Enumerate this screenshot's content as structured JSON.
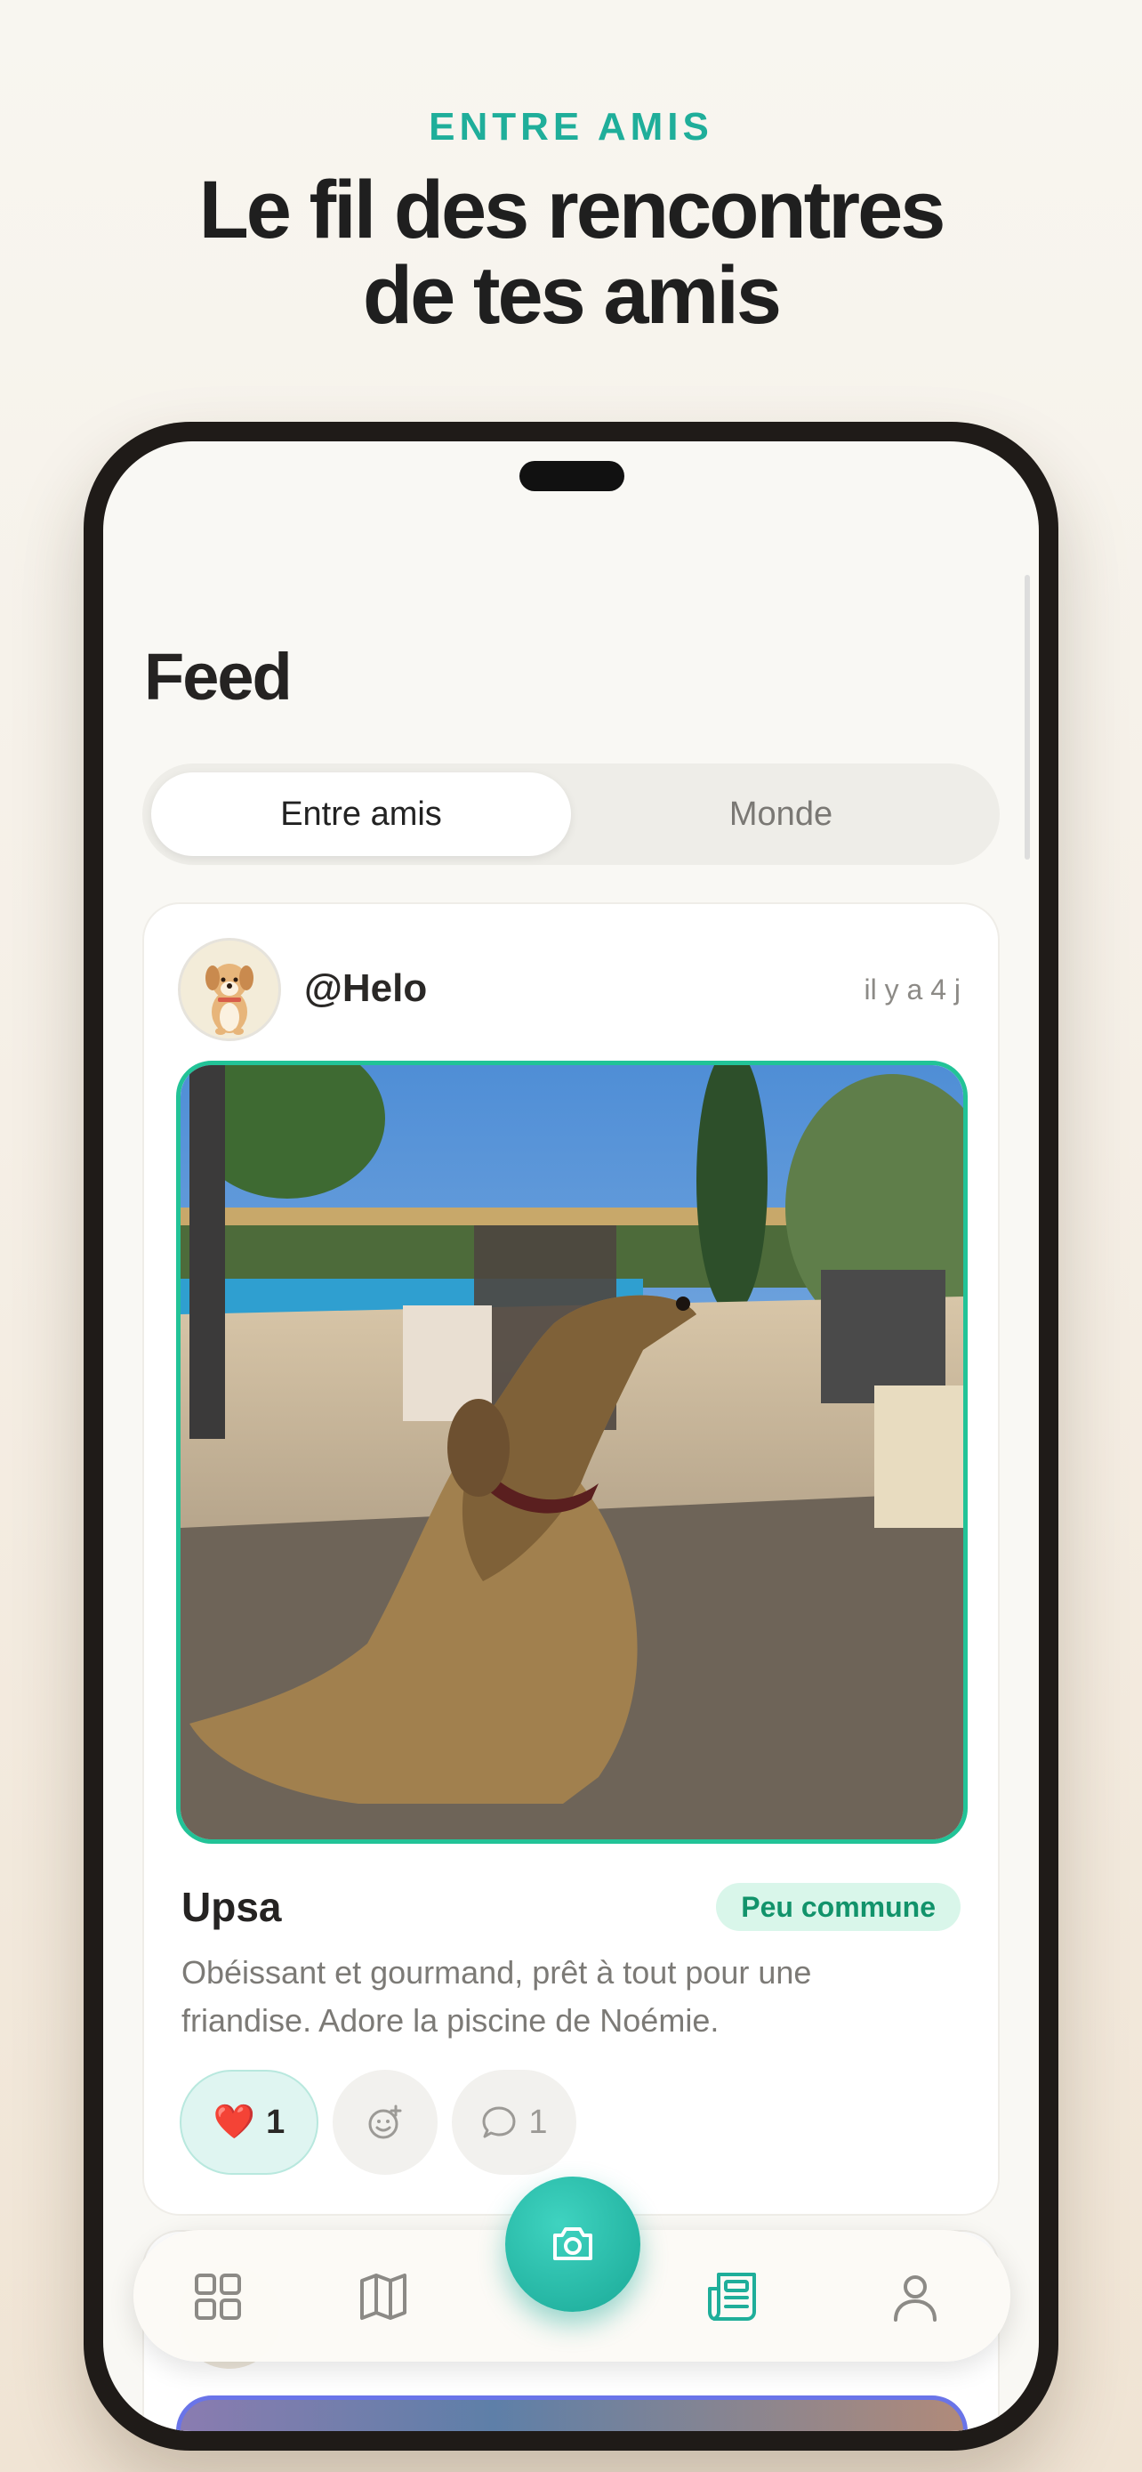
{
  "promo": {
    "eyebrow": "ENTRE AMIS",
    "headline_line1": "Le fil des rencontres",
    "headline_line2": "de tes amis"
  },
  "screen": {
    "title": "Feed",
    "tabs": [
      {
        "label": "Entre amis",
        "active": true
      },
      {
        "label": "Monde",
        "active": false
      }
    ]
  },
  "post": {
    "username": "@Helo",
    "time": "il y a 4 j",
    "pet_name": "Upsa",
    "rarity": "Peu commune",
    "description": "Obéissant et gourmand, prêt à tout pour une friandise. Adore la piscine de Noémie.",
    "likes": {
      "emoji": "❤️",
      "count": "1"
    },
    "comments": {
      "count": "1"
    },
    "colors": {
      "photo_border": "#22c397",
      "rarity_bg": "#d9f6ea",
      "rarity_text": "#12936b"
    }
  },
  "tabbar": {
    "items": [
      "grid-icon",
      "map-icon",
      "camera-icon",
      "feed-icon",
      "profile-icon"
    ],
    "active": "feed-icon",
    "accent": "#1fae9a"
  }
}
